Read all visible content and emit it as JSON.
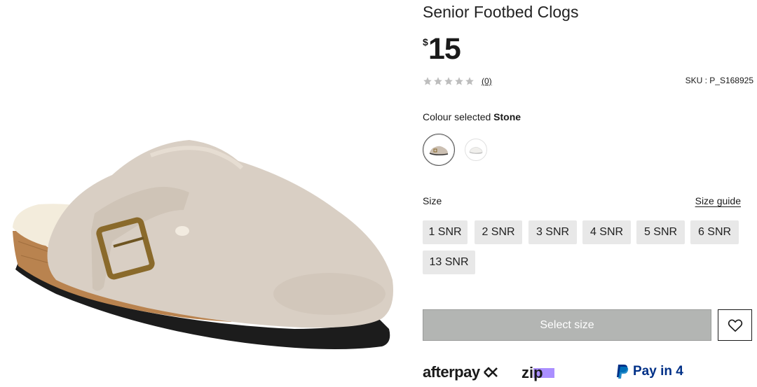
{
  "product": {
    "title": "Senior Footbed Clogs",
    "currency": "$",
    "price": "15",
    "rating": {
      "stars_filled": 0,
      "stars_total": 5,
      "review_count": "(0)"
    },
    "sku": "SKU : P_S168925"
  },
  "colour": {
    "label": "Colour selected",
    "selected": "Stone",
    "swatches": [
      "Stone",
      "White"
    ]
  },
  "size": {
    "label": "Size",
    "guide_label": "Size guide",
    "options": [
      "1 SNR",
      "2 SNR",
      "3 SNR",
      "4 SNR",
      "5 SNR",
      "6 SNR",
      "13 SNR"
    ]
  },
  "actions": {
    "select_size_label": "Select size",
    "wishlist_icon": "heart-icon"
  },
  "payments": {
    "afterpay": "afterpay",
    "zip": "zip",
    "paypal": "Pay in 4"
  },
  "colors": {
    "select_button_bg": "#b3b5b3",
    "size_chip_bg": "#e8e8e8",
    "paypal_blue": "#003087",
    "zip_purple": "#aa8fff",
    "product_suede": "#d9cfc4"
  }
}
